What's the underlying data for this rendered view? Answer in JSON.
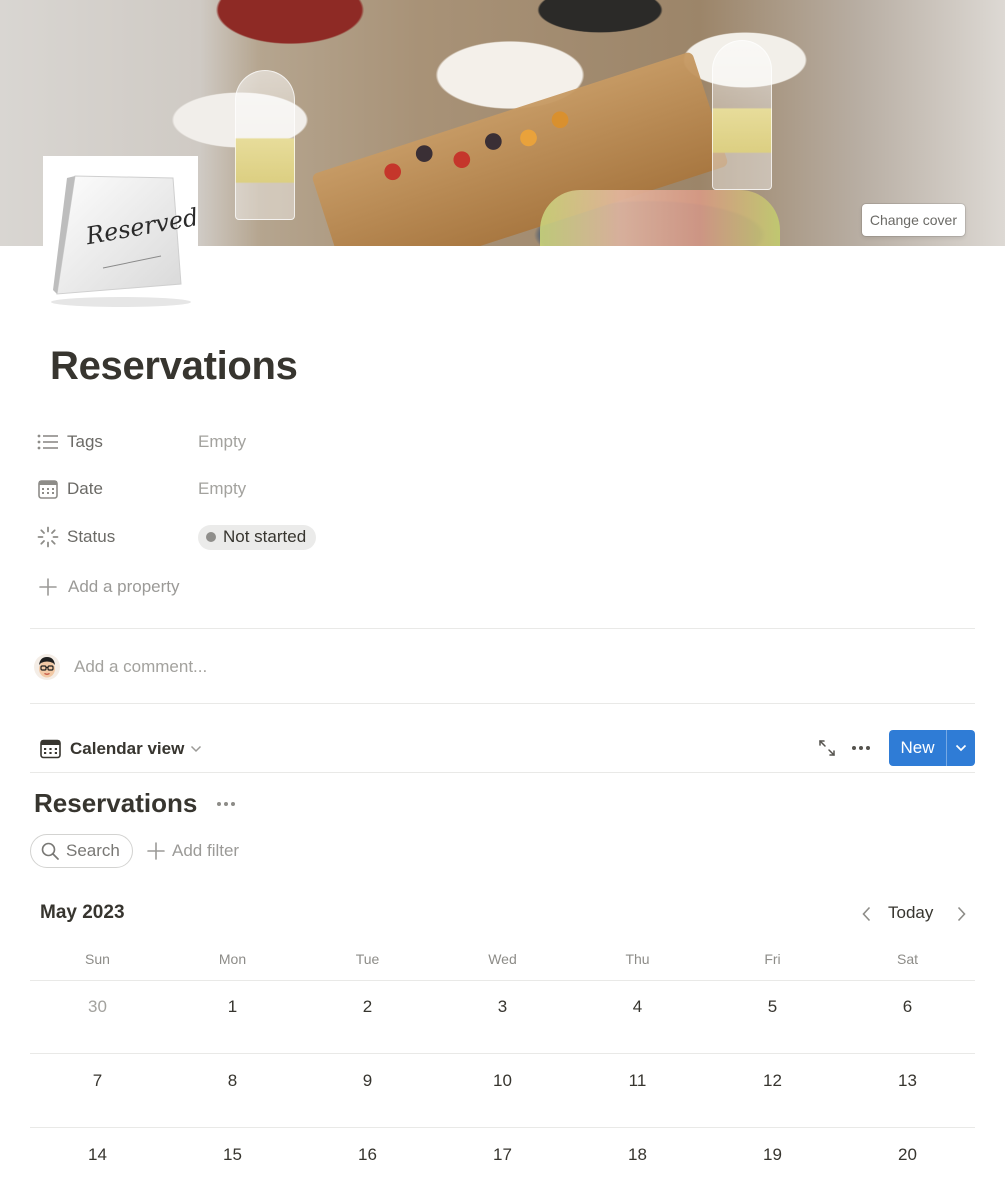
{
  "cover": {
    "change_cover_label": "Change cover"
  },
  "page": {
    "title": "Reservations",
    "icon_text": "Reserved"
  },
  "properties": [
    {
      "icon": "list-icon",
      "label": "Tags",
      "value": "Empty"
    },
    {
      "icon": "calendar-icon",
      "label": "Date",
      "value": "Empty"
    },
    {
      "icon": "status-spinner-icon",
      "label": "Status",
      "value": "Not started",
      "dot_color": "#8f8e8b"
    }
  ],
  "add_property_label": "Add a property",
  "comment": {
    "placeholder": "Add a comment..."
  },
  "view": {
    "label": "Calendar view",
    "new_label": "New",
    "accent": "#2f7cd6"
  },
  "database": {
    "title": "Reservations",
    "search_label": "Search",
    "add_filter_label": "Add filter"
  },
  "calendar": {
    "month": "May 2023",
    "today_label": "Today",
    "weekdays": [
      "Sun",
      "Mon",
      "Tue",
      "Wed",
      "Thu",
      "Fri",
      "Sat"
    ],
    "weeks": [
      [
        "30",
        "1",
        "2",
        "3",
        "4",
        "5",
        "6"
      ],
      [
        "7",
        "8",
        "9",
        "10",
        "11",
        "12",
        "13"
      ],
      [
        "14",
        "15",
        "16",
        "17",
        "18",
        "19",
        "20"
      ]
    ]
  }
}
